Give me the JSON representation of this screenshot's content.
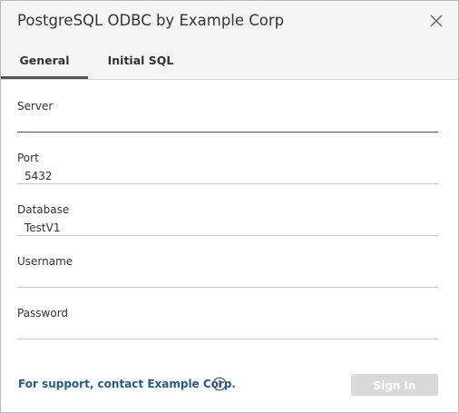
{
  "dialog": {
    "title": "PostgreSQL ODBC by Example Corp",
    "close_icon": "close-icon"
  },
  "tabs": [
    {
      "label": "General",
      "active": true
    },
    {
      "label": "Initial SQL",
      "active": false
    }
  ],
  "fields": {
    "server": {
      "label": "Server",
      "value": ""
    },
    "port": {
      "label": "Port",
      "value": "5432"
    },
    "database": {
      "label": "Database",
      "value": "TestV1"
    },
    "username": {
      "label": "Username",
      "value": ""
    },
    "password": {
      "label": "Password",
      "value": ""
    }
  },
  "footer": {
    "support_text": "For support, contact Example Corp.",
    "info_icon": "info-icon",
    "signin_label": "Sign In"
  },
  "colors": {
    "active_underline": "#a8283b",
    "link": "#1f5c8c",
    "button_disabled": "#d9d9d9"
  }
}
